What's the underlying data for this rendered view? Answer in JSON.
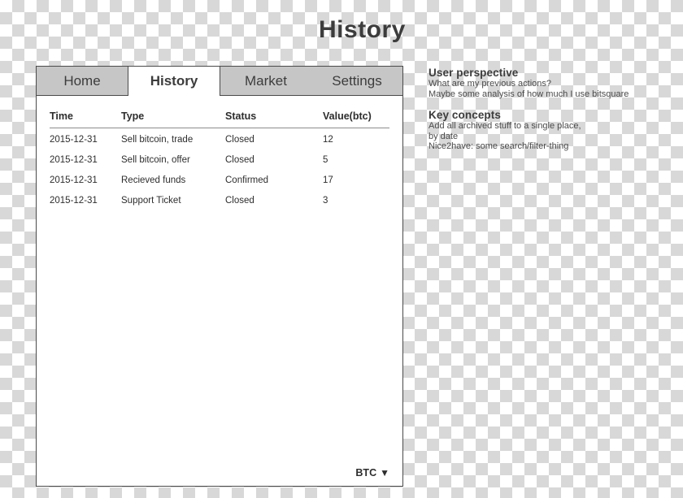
{
  "page": {
    "title": "History"
  },
  "window": {
    "tabs": [
      {
        "label": "Home",
        "active": false
      },
      {
        "label": "History",
        "active": true
      },
      {
        "label": "Market",
        "active": false
      },
      {
        "label": "Settings",
        "active": false
      }
    ],
    "table": {
      "headers": [
        "Time",
        "Type",
        "Status",
        "Value(btc)"
      ],
      "rows": [
        [
          "2015-12-31",
          "Sell bitcoin, trade",
          "Closed",
          "12"
        ],
        [
          "2015-12-31",
          "Sell bitcoin, offer",
          "Closed",
          "5"
        ],
        [
          "2015-12-31",
          "Recieved funds",
          "Confirmed",
          "17"
        ],
        [
          "2015-12-31",
          "Support Ticket",
          "Closed",
          "3"
        ]
      ]
    },
    "footer": {
      "currency_label": "BTC",
      "caret": "▼"
    }
  },
  "notes": {
    "user_perspective": {
      "heading": "User perspective",
      "line1": "What are my previous actions?",
      "line2": "Maybe some analysis of how much I use bitsquare"
    },
    "key_concepts": {
      "heading": "Key concepts",
      "line1": "Add all archived stuff to a single place,",
      "line2": "by date",
      "line3": "Nice2have: some search/filter-thing"
    }
  }
}
